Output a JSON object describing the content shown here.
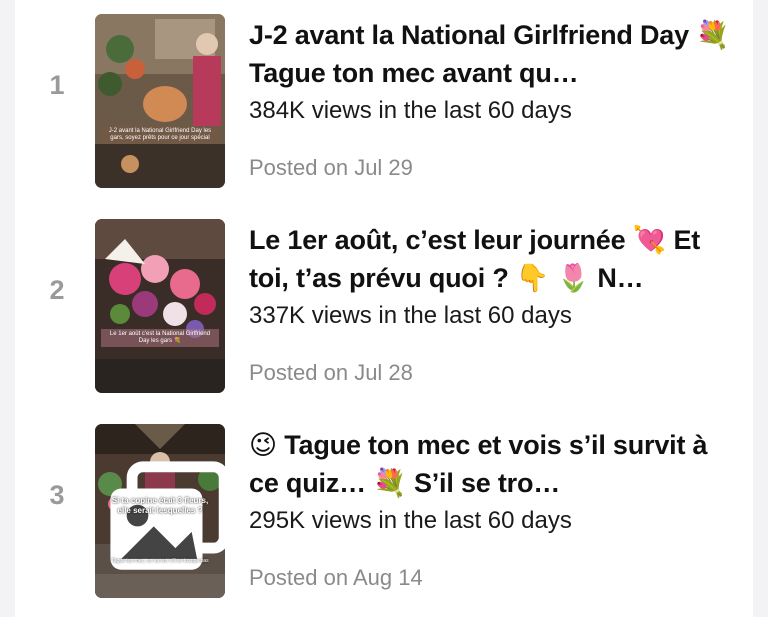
{
  "videos": [
    {
      "rank": "1",
      "title": "J-2 avant la National Girlfriend Day 💐 Tague ton mec avant qu…",
      "views": "384K views in the last 60 days",
      "posted": "Posted on Jul 29",
      "thumbnail_caption": "J-2 avant la National Girlfriend Day les gars, soyez prêts pour ce jour spécial"
    },
    {
      "rank": "2",
      "title": "Le 1er août, c’est leur journée 💘 Et toi, t’as prévu quoi ? 👇 🌷 N…",
      "views": "337K views in the last 60 days",
      "posted": "Posted on Jul 28",
      "thumbnail_caption": "Le 1er août c'est la National Girlfriend Day les gars 💐"
    },
    {
      "rank": "3",
      "title": "😉 Tague ton mec et vois s’il survit à ce quiz… 💐 S’il se tro…",
      "views": "295K views in the last 60 days",
      "posted": "Posted on Aug 14",
      "thumbnail_caption": "Si ta copine était 3 fleurs, elle serait lesquelles ?",
      "thumbnail_subcaption": "Tague ton mec, on va voir s'il se trompe pas"
    }
  ]
}
